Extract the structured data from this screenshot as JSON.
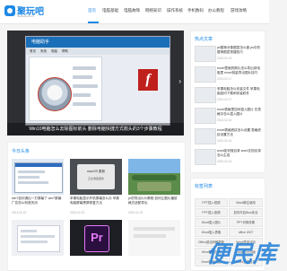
{
  "logo": {
    "text": "聚玩吧",
    "subtitle": "Jüwanba.com"
  },
  "nav": {
    "items": [
      "首页",
      "电脑基础",
      "电脑故障",
      "网络知识",
      "操作系统",
      "手机数码",
      "办公教程",
      "游戏攻略"
    ],
    "active_index": 0
  },
  "hero": {
    "window_title": "电脑助手",
    "menu": [
      "首页",
      "系统",
      "电脑",
      "帮助"
    ],
    "flash_icon": "f",
    "caption": "Win10电脑怎么去除图标箭头 删除电脑快捷方式箭头的3个步骤教程"
  },
  "hot": {
    "title": "热点文章",
    "items": [
      {
        "title": "ps替换对象图层怎么做 ps中的替换图层快捷技巧",
        "date": "2023-02-15"
      },
      {
        "title": "excel里面的照片怎么导出到电脑里 excel批量导出图片技巧",
        "date": "2023-02-17"
      },
      {
        "title": "苹果电脑怎么安装文件 苹果电脑如何下载和安装软件",
        "date": "2023-02-17"
      },
      {
        "title": "excel表格里如何插入图片 在表格中怎么插入图片",
        "date": "2023-02-16"
      },
      {
        "title": "excel表格底纹怎么设置 表格底纹设置方法",
        "date": "2023-02-16"
      },
      {
        "title": "word如何做目录 word文档目录怎么生成",
        "date": "2023-02-16"
      }
    ]
  },
  "today": {
    "title": "今日头条",
    "cards": [
      {
        "title": "win7如何调出一打屏幕了 win7屏幕广告怎么彻底关闭",
        "date": "2023-02-23"
      },
      {
        "title": "苹果电脑显示开机屏幕怎么办 苹果电脑屏幕黑屏修复方法",
        "date": "2023-02-23"
      },
      {
        "title": "pr的导出片片教程 如何让图片播放格式适配导出",
        "date": "2023-02-23"
      }
    ],
    "card2_window_title": "macOS 更新",
    "card2_subtitle": "正在准备更新",
    "card5_logo": "Pr"
  },
  "tags": {
    "title": "标签列表",
    "items": [
      "PPT插入视频",
      "Word脚注使用",
      "PPT插入音频",
      "如何开启Bios安全",
      "Word插入图片",
      "PPT切换效果",
      "Word插入表格",
      "office 2007",
      "Office激活码都更新",
      "Word是激活码",
      "Word数据分析",
      "Excel中不同版",
      "Excel转化问题",
      "Word生成目录"
    ]
  },
  "watermark": {
    "text": "便民库"
  },
  "colors": {
    "accent": "#1e88e5",
    "flash": "#c0201c",
    "pr_bg": "#2a0f3f",
    "pr_fg": "#e879f9"
  }
}
